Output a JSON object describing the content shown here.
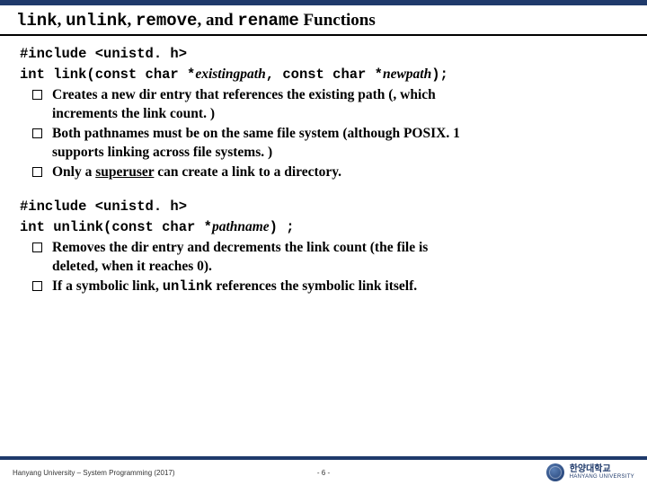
{
  "title": {
    "part1": "link",
    "sep": ", ",
    "part2": "unlink",
    "part3": "remove",
    "and": ", and ",
    "part4": "rename",
    "tail": " Functions"
  },
  "block1": {
    "include": "#include <unistd. h>",
    "sig_pre": "int link(const char *",
    "sig_arg1": "existingpath",
    "sig_mid": ", const char *",
    "sig_arg2": "newpath",
    "sig_post": ");",
    "b1_a": "Creates a new dir entry that references the existing path (, which",
    "b1_b": "increments the link count. )",
    "b2_a": "Both pathnames must be on the same file system (although POSIX. 1",
    "b2_b": "supports linking across file systems. )",
    "b3_a": "Only a ",
    "b3_key": "superuser",
    "b3_b": " can create a link to a directory."
  },
  "block2": {
    "include": "#include <unistd. h>",
    "sig_pre": "int unlink(const char *",
    "sig_arg": "pathname",
    "sig_post": ") ;",
    "b1_a": "Removes the dir entry and decrements the link count (the file is",
    "b1_b": "deleted, when it reaches 0).",
    "b2_a": "If a symbolic link, ",
    "b2_code": "unlink",
    "b2_b": " references the symbolic link itself."
  },
  "footer": {
    "left": "Hanyang University – System Programming (2017)",
    "page": "- 6 -",
    "uni_ko": "한양대학교",
    "uni_en": "HANYANG UNIVERSITY"
  }
}
